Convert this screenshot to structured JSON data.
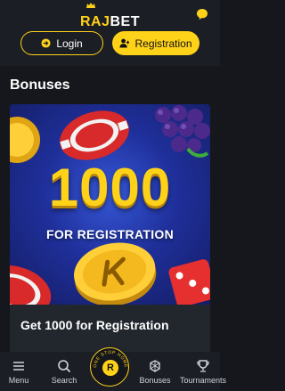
{
  "header": {
    "logo_part1": "RAJ",
    "logo_part2": "BET",
    "login_label": "Login",
    "register_label": "Registration"
  },
  "page": {
    "title": "Bonuses"
  },
  "promo": {
    "banner_number": "1000",
    "banner_subtitle": "FOR REGISTRATION",
    "card_title": "Get 1000 for Registration"
  },
  "bottom_nav": {
    "menu": "Menu",
    "search": "Search",
    "home_ring": "ONE STOP HOME",
    "home_letter": "R",
    "bonuses": "Bonuses",
    "tournaments": "Tournaments"
  },
  "colors": {
    "accent": "#ffd21a",
    "background": "#15171c",
    "header": "#1b1e24",
    "card": "#22262d"
  },
  "icons": [
    "crown-icon",
    "chat-icon",
    "login-arrow-icon",
    "user-icon",
    "menu-icon",
    "search-icon",
    "gift-icon",
    "trophy-icon"
  ]
}
